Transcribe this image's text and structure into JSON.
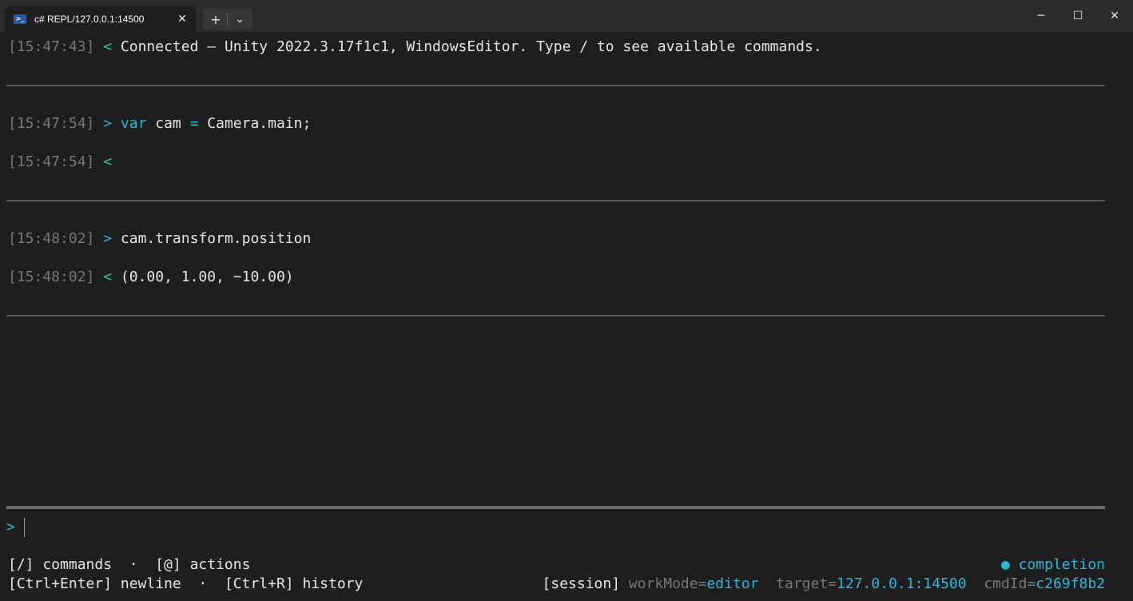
{
  "window": {
    "tab_icon": "terminal-icon",
    "tab_icon_glyph": ">_",
    "tab_title": "c# REPL/127.0.0.1:14500",
    "close_glyph": "✕",
    "new_tab_glyph": "+",
    "dropdown_glyph": "⌄",
    "minimize_glyph": "─",
    "maximize_glyph": "☐",
    "window_close_glyph": "✕"
  },
  "log": [
    {
      "time": "[15:47:43]",
      "dir": "<",
      "text": " Connected — Unity 2022.3.17f1c1, WindowsEditor. Type / to see available commands."
    },
    {
      "time": "[15:47:54]",
      "dir": ">",
      "kw": "var",
      "rest1": " cam ",
      "eq": "=",
      "rest2": " Camera.main;"
    },
    {
      "time": "[15:47:54]",
      "dir": "<",
      "text": ""
    },
    {
      "time": "[15:48:02]",
      "dir": ">",
      "text": " cam.transform.position"
    },
    {
      "time": "[15:48:02]",
      "dir": "<",
      "text": " (0.00, 1.00, −10.00)"
    }
  ],
  "prompt": {
    "symbol": ">"
  },
  "footer": {
    "commands": "[/] commands",
    "sep1": "  ·  ",
    "actions": "[@] actions",
    "newline": "[Ctrl+Enter] newline",
    "sep2": "  ·  ",
    "history": "[Ctrl+R] history",
    "completion_dot": "●",
    "completion": " completion",
    "session": "[session]",
    "workmode_key": " workMode=",
    "workmode_val": "editor",
    "target_key": "  target=",
    "target_val": "127.0.0.1:14500",
    "cmdid_key": "  cmdId=",
    "cmdid_val": "c269f8b2"
  },
  "colors": {
    "background": "#1e1e1e",
    "accent": "#29b8db",
    "output_arrow": "#23d18b",
    "timestamp": "#767676"
  }
}
